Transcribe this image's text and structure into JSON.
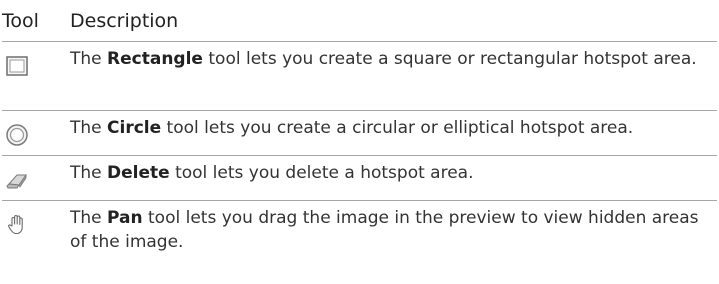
{
  "header": {
    "tool": "Tool",
    "description": "Description"
  },
  "rows": [
    {
      "icon": "rectangle-tool-icon",
      "pre": "The ",
      "name": "Rectangle",
      "post": " tool lets you create a square or rectangular hotspot area."
    },
    {
      "icon": "circle-tool-icon",
      "pre": "The ",
      "name": "Circle",
      "post": " tool lets you create a circular or elliptical hotspot area."
    },
    {
      "icon": "eraser-tool-icon",
      "pre": "The ",
      "name": "Delete",
      "post": " tool lets you delete a hotspot area."
    },
    {
      "icon": "hand-tool-icon",
      "pre": "The ",
      "name": "Pan",
      "post": " tool lets you drag the image in the preview to view hidden areas of the image."
    }
  ]
}
